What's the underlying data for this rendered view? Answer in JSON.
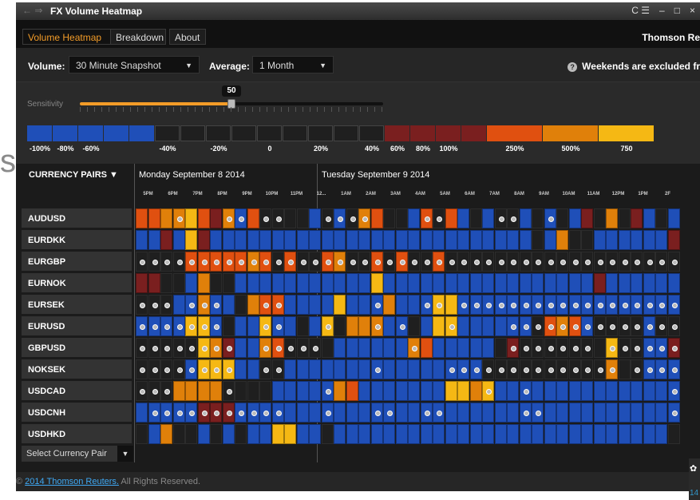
{
  "background_fragment": "s",
  "window": {
    "title": "FX Volume Heatmap",
    "nav": "← ⇒",
    "controls": [
      "C ☰",
      "–",
      "□",
      "×"
    ]
  },
  "tabs": [
    "Volume Heatmap",
    "Breakdown",
    "About"
  ],
  "brand": "Thomson Re",
  "controls": {
    "volume_label": "Volume:",
    "volume_value": "30 Minute Snapshot",
    "average_label": "Average:",
    "average_value": "1 Month",
    "note": "Weekends are excluded fr"
  },
  "sensitivity": {
    "label": "Sensitivity",
    "value": 50,
    "value_text": "50"
  },
  "scale": [
    {
      "color": "#1f4fb8",
      "label": "-100%"
    },
    {
      "color": "#1f4fb8",
      "label": "-80%"
    },
    {
      "color": "#1f4fb8",
      "label": "-60%"
    },
    {
      "color": "#1f4fb8",
      "label": ""
    },
    {
      "color": "#1f4fb8",
      "label": ""
    },
    {
      "color": "#1f1f1f",
      "label": "-40%"
    },
    {
      "color": "#1f1f1f",
      "label": ""
    },
    {
      "color": "#1f1f1f",
      "label": "-20%"
    },
    {
      "color": "#1f1f1f",
      "label": ""
    },
    {
      "color": "#1f1f1f",
      "label": "0"
    },
    {
      "color": "#1f1f1f",
      "label": ""
    },
    {
      "color": "#1f1f1f",
      "label": "20%"
    },
    {
      "color": "#1f1f1f",
      "label": ""
    },
    {
      "color": "#1f1f1f",
      "label": "40%"
    },
    {
      "color": "#7a1f1f",
      "label": "60%"
    },
    {
      "color": "#7a1f1f",
      "label": "80%"
    },
    {
      "color": "#7a1f1f",
      "label": "100%"
    },
    {
      "color": "#7a1f1f",
      "label": ""
    },
    {
      "color": "#e05010",
      "label": "250%"
    },
    {
      "color": "#e0800a",
      "label": "500%"
    },
    {
      "color": "#f5b814",
      "label": "750"
    }
  ],
  "grid": {
    "pairs_header": "CURRENCY PAIRS ▼",
    "days": [
      "Monday September 8 2014",
      "Tuesday September 9 2014"
    ],
    "hours_mon": [
      "5PM",
      "6PM",
      "7PM",
      "8PM",
      "9PM",
      "10PM",
      "11PM"
    ],
    "hours_tue": [
      "12...",
      "1AM",
      "2AM",
      "3AM",
      "4AM",
      "5AM",
      "6AM",
      "7AM",
      "8AM",
      "9AM",
      "10AM",
      "11AM",
      "12PM",
      "1PM",
      "2F"
    ],
    "pairs": [
      "AUDUSD",
      "EURDKK",
      "EURGBP",
      "EURNOK",
      "EURSEK",
      "EURUSD",
      "GBPUSD",
      "NOKSEK",
      "USDCAD",
      "USDCNH",
      "USDHKD"
    ],
    "colors": {
      "d": "#1f1f1f",
      "b": "#1f4fb8",
      "r": "#7a1f1f",
      "o": "#e05010",
      "a": "#e0800a",
      "y": "#f5b814",
      "l": "#ffe24a"
    },
    "rows": [
      "ooaayoraboddddbdbdaoddbodobdbddbdbdbrdadrbdb",
      "bbrbyrbbbbbbbbbbbbbbbbbbbbbbbbbbdbaddbbbbbbr",
      "ddddoooooaododdoaddododdoddddddddddddddddddd",
      "rrddbaddbbbbbbbbbbbybbbbbbbbbbbbbbbbbrbbbbbb",
      "dddbbabbdaoobbbbybbbabbbyybbbbbbbbbbbbbbbbbb",
      "bbbbyybdbbybbdbydaaabbdbyybbbbbbdoaobddddbdd",
      "dddddyarbbaoddddbbbbbbaobbbbbdrdddddddyddbbr",
      "ddddbyyybbddbbbbbbbbbbbbbbbbddddddddddaddbbb",
      "dddaaaaddddbbbbbaobbbbbbbyyaybbbbbbbbbbbbbbb",
      "bbbbbrrrbbbbbbbbbbbbbbbbbbbbbbbbbbbbbbbbbbbb",
      "dbaddbdbdbbyybbdbbbbbbbbbbbbbbbbbbbbbbbbbbbd"
    ],
    "dots": [
      "00010001101100011110000110000110010000000000",
      "00000000000000000000000000000000000000000000",
      "11111111111111111111111111111111111111111111",
      "00000000000000000000000000000000000000000000",
      "11101110001100000001000110111111111111111111",
      "11111110001100010001010001000011111111111111",
      "11111111001111100000001000000011111110111111",
      "11111111001100000001000001111111111111101111",
      "11100001000000010000000000001001000000000001",
      "01111111111100010001100110000001100000000001",
      "00000000000000000000000000000000000000000000"
    ]
  },
  "select_pair": {
    "label": "Select Currency Pair",
    "button": "▼"
  },
  "footer": {
    "prefix": "© ",
    "link": "2014 Thomson Reuters.",
    "suffix": " All Rights Reserved."
  },
  "corner": {
    "icon": "✿",
    "text": "14"
  }
}
